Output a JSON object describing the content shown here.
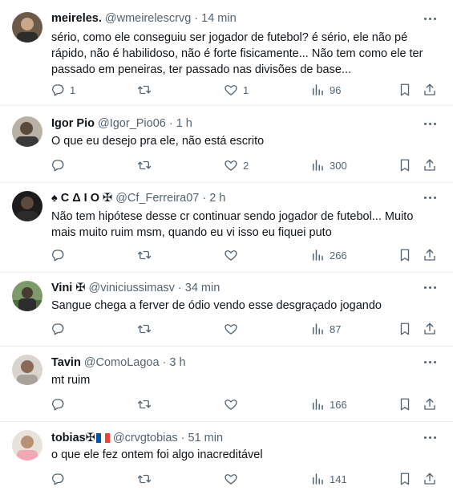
{
  "tweets": [
    {
      "name": "meireles.",
      "handle": "@wmeirelescrvg",
      "dot": "·",
      "time": "14 min",
      "text": "sério, como ele conseguiu ser jogador de futebol? é sério, ele não pé rápido, não é habilidoso, não é forte fisicamente... Não tem como ele ter passado em peneiras, ter passado nas divisões de base...",
      "replies": "1",
      "retweets": "",
      "likes": "1",
      "views": "96"
    },
    {
      "name": "Igor Pio",
      "handle": "@Igor_Pio06",
      "dot": "·",
      "time": "1 h",
      "text": "O que eu desejo pra ele, não está escrito",
      "replies": "",
      "retweets": "",
      "likes": "2",
      "views": "300"
    },
    {
      "name": "♠ C Δ I O ✠",
      "handle": "@Cf_Ferreira07",
      "dot": "·",
      "time": "2 h",
      "text": "Não tem hipótese desse cr continuar sendo jogador de futebol... Muito mais muito ruim msm, quando eu vi isso eu fiquei puto",
      "replies": "",
      "retweets": "",
      "likes": "",
      "views": "266"
    },
    {
      "name": "Vini ✠",
      "handle": "@viniciussimasv",
      "dot": "·",
      "time": "34 min",
      "text": "Sangue chega a ferver de ódio vendo esse desgraçado jogando",
      "replies": "",
      "retweets": "",
      "likes": "",
      "views": "87"
    },
    {
      "name": "Tavin",
      "handle": "@ComoLagoa",
      "dot": "·",
      "time": "3 h",
      "text": "mt ruim",
      "replies": "",
      "retweets": "",
      "likes": "",
      "views": "166"
    },
    {
      "name": "tobias✠",
      "handle": "@crvgtobias",
      "dot": "·",
      "time": "51 min",
      "text": "o que ele fez ontem foi algo inacreditável",
      "replies": "",
      "retweets": "",
      "likes": "",
      "views": "141"
    }
  ],
  "icons": {
    "reply": "reply-icon",
    "retweet": "retweet-icon",
    "like": "heart-icon",
    "views": "views-icon",
    "bookmark": "bookmark-icon",
    "share": "share-icon",
    "more": "more-icon"
  },
  "colors": {
    "text": "#0f1419",
    "secondary": "#536471",
    "divider": "#e8ecef",
    "flag_blue": "#0055a4",
    "flag_white": "#ffffff",
    "flag_red": "#ef4135"
  }
}
